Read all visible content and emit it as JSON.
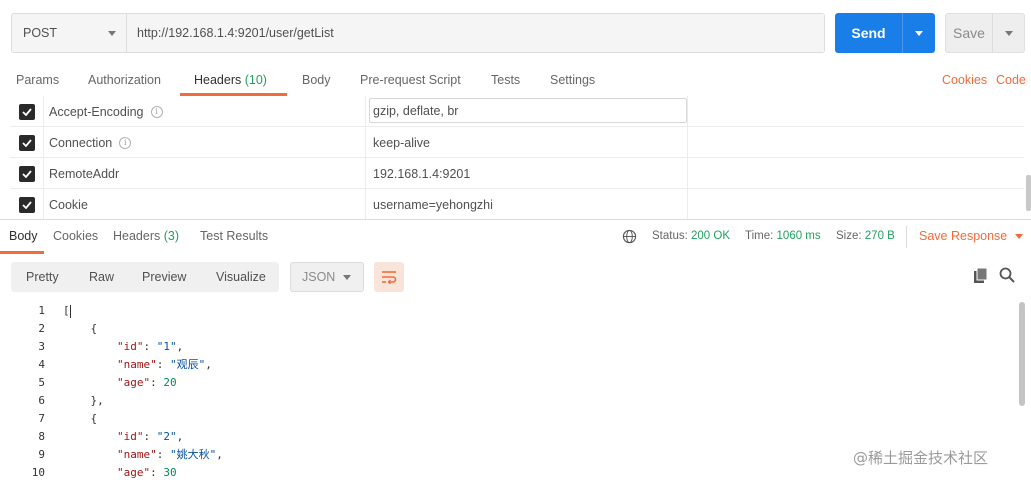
{
  "request": {
    "method": "POST",
    "url": "http://192.168.1.4:9201/user/getList",
    "send_label": "Send",
    "save_label": "Save"
  },
  "request_tabs": [
    {
      "label": "Params"
    },
    {
      "label": "Authorization"
    },
    {
      "label": "Headers",
      "count": "(10)",
      "active": true
    },
    {
      "label": "Body"
    },
    {
      "label": "Pre-request Script"
    },
    {
      "label": "Tests"
    },
    {
      "label": "Settings"
    }
  ],
  "request_links": {
    "cookies": "Cookies",
    "code": "Code"
  },
  "headers": [
    {
      "key": "Accept-Encoding",
      "value": "gzip, deflate, br",
      "checked": true,
      "info": true
    },
    {
      "key": "Connection",
      "value": "keep-alive",
      "checked": true,
      "info": true
    },
    {
      "key": "RemoteAddr",
      "value": "192.168.1.4:9201",
      "checked": true,
      "info": false
    },
    {
      "key": "Cookie",
      "value": "username=yehongzhi",
      "checked": true,
      "info": false
    }
  ],
  "response_tabs": [
    {
      "label": "Body",
      "active": true
    },
    {
      "label": "Cookies"
    },
    {
      "label": "Headers",
      "count": "(3)"
    },
    {
      "label": "Test Results"
    }
  ],
  "status": {
    "status_label": "Status:",
    "status_value": "200 OK",
    "time_label": "Time:",
    "time_value": "1060 ms",
    "size_label": "Size:",
    "size_value": "270 B",
    "save_response": "Save Response"
  },
  "view_modes": [
    "Pretty",
    "Raw",
    "Preview",
    "Visualize"
  ],
  "format": "JSON",
  "code_lines": [
    {
      "n": "1",
      "html": "["
    },
    {
      "n": "2",
      "html": "    {"
    },
    {
      "n": "3",
      "html": "        <span class=\"k\">\"id\"</span>: <span class=\"s\">\"1\"</span>,"
    },
    {
      "n": "4",
      "html": "        <span class=\"k\">\"name\"</span>: <span class=\"s\">\"观辰\"</span>,"
    },
    {
      "n": "5",
      "html": "        <span class=\"k\">\"age\"</span>: <span class=\"n\">20</span>"
    },
    {
      "n": "6",
      "html": "    },"
    },
    {
      "n": "7",
      "html": "    {"
    },
    {
      "n": "8",
      "html": "        <span class=\"k\">\"id\"</span>: <span class=\"s\">\"2\"</span>,"
    },
    {
      "n": "9",
      "html": "        <span class=\"k\">\"name\"</span>: <span class=\"s\">\"姚大秋\"</span>,"
    },
    {
      "n": "10",
      "html": "        <span class=\"k\">\"age\"</span>: <span class=\"n\">30</span>"
    }
  ],
  "watermark": "@稀土掘金技术社区",
  "colors": {
    "accent": "#f26b3a",
    "send": "#1a7ee8",
    "success": "#20a060"
  }
}
